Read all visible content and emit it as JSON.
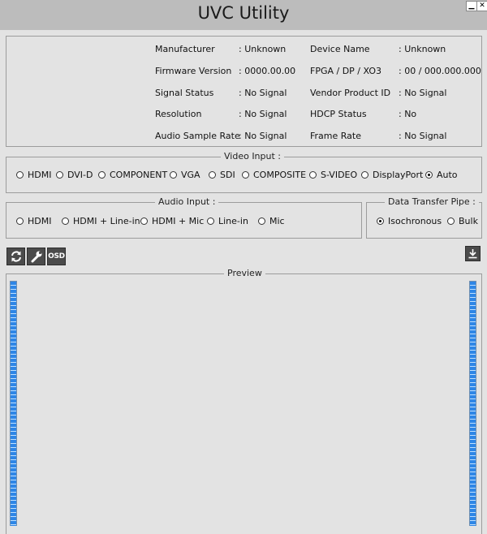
{
  "window": {
    "title": "UVC Utility",
    "minimize_glyph": "▁",
    "close_glyph": "✕"
  },
  "info": {
    "rows": [
      {
        "l_label": "Manufacturer",
        "l_value": ": Unknown",
        "r_label": "Device Name",
        "r_value": ": Unknown"
      },
      {
        "l_label": "Firmware Version",
        "l_value": ": 0000.00.00",
        "r_label": "FPGA / DP / XO3",
        "r_value": ": 00 / 000.000.000"
      },
      {
        "l_label": "Signal Status",
        "l_value": ": No Signal",
        "r_label": "Vendor  Product ID",
        "r_value": ": No Signal"
      },
      {
        "l_label": "Resolution",
        "l_value": ": No Signal",
        "r_label": "HDCP Status",
        "r_value": ": No"
      },
      {
        "l_label": "Audio Sample Rate",
        "l_value": ": No Signal",
        "r_label": "Frame Rate",
        "r_value": ": No Signal"
      }
    ]
  },
  "video_input": {
    "legend": "Video Input :",
    "options": [
      "HDMI",
      "DVI-D",
      "COMPONENT",
      "VGA",
      "SDI",
      "COMPOSITE",
      "S-VIDEO",
      "DisplayPort",
      "Auto"
    ],
    "selected": "Auto"
  },
  "audio_input": {
    "legend": "Audio Input :",
    "options": [
      "HDMI",
      "HDMI + Line-in",
      "HDMI + Mic",
      "Line-in",
      "Mic"
    ],
    "selected": null
  },
  "transfer": {
    "legend": "Data Transfer Pipe :",
    "options": [
      "Isochronous",
      "Bulk"
    ],
    "selected": "Isochronous"
  },
  "toolbar": {
    "refresh_icon": "refresh-icon",
    "settings_icon": "wrench-icon",
    "osd_label": "OSD",
    "download_icon": "download-icon"
  },
  "preview": {
    "legend": "Preview"
  },
  "colors": {
    "meter_fill": "#2e86e6",
    "meter_gap": "#bfe0ff",
    "button_dark": "#4b4b4b"
  }
}
